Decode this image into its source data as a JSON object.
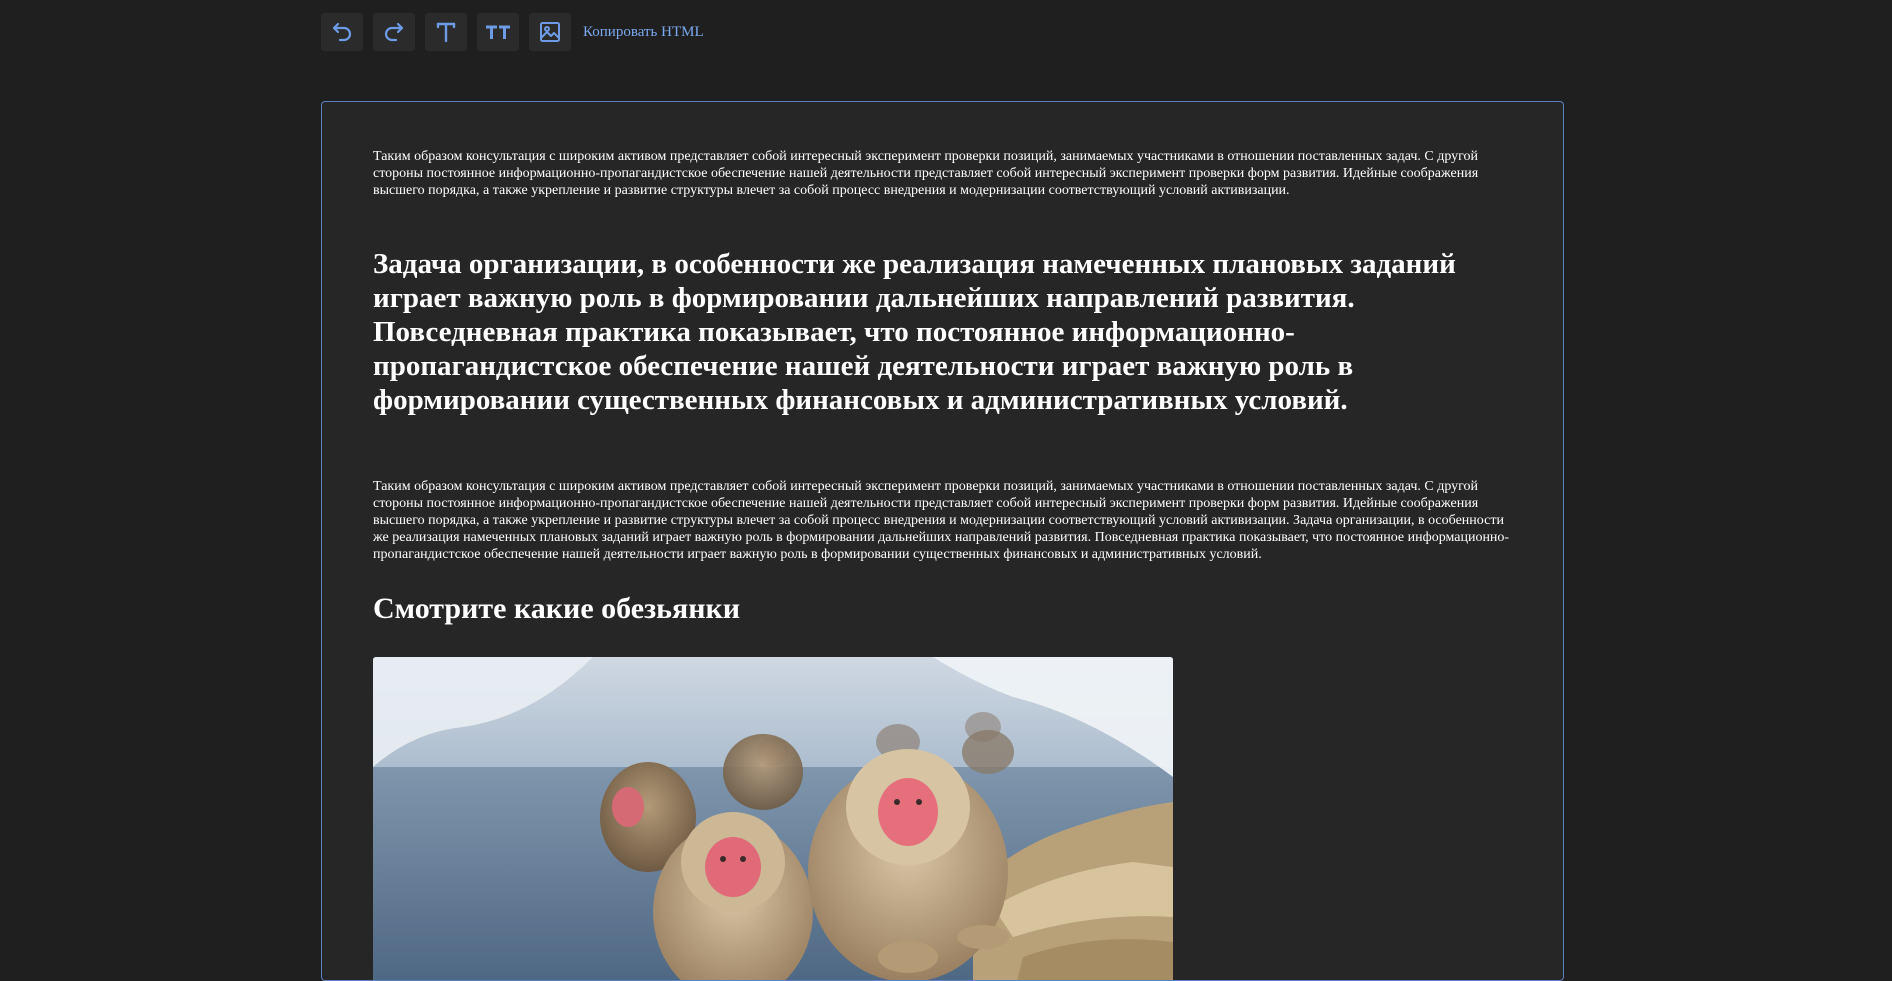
{
  "toolbar": {
    "buttons": [
      {
        "icon": "undo-icon"
      },
      {
        "icon": "redo-icon"
      },
      {
        "icon": "text-icon"
      },
      {
        "icon": "heading-icon"
      },
      {
        "icon": "image-icon"
      }
    ],
    "copy_label": "Копировать HTML",
    "icon_color": "#6d9be6",
    "button_bg": "#2b2b2b"
  },
  "editor": {
    "border_color": "#5a80c2",
    "background": "#262626",
    "paragraph_1": "Таким образом консультация с широким активом представляет собой интересный эксперимент проверки позиций, занимаемых участниками в отношении поставленных задач. С другой стороны постоянное информационно-пропагандистское обеспечение нашей деятельности представляет собой интересный эксперимент проверки форм развития. Идейные соображения высшего порядка, а также укрепление и развитие структуры влечет за собой процесс внедрения и модернизации соответствующий условий активизации.",
    "heading_1": "Задача организации, в особенности же реализация намеченных плановых заданий играет важную роль в формировании дальнейших направлений развития. Повседневная практика показывает, что постоянное информационно-пропагандистское обеспечение нашей деятельности играет важную роль в формировании существенных финансовых и административных условий.",
    "paragraph_2": "Таким образом консультация с широким активом представляет собой интересный эксперимент проверки позиций, занимаемых участниками в отношении поставленных задач. С другой стороны постоянное информационно-пропагандистское обеспечение нашей деятельности представляет собой интересный эксперимент проверки форм развития. Идейные соображения высшего порядка, а также укрепление и развитие структуры влечет за собой процесс внедрения и модернизации соответствующий условий активизации. Задача организации, в особенности же реализация намеченных плановых заданий играет важную роль в формировании дальнейших направлений развития. Повседневная практика показывает, что постоянное информационно-пропагандистское обеспечение нашей деятельности играет важную роль в формировании существенных финансовых и административных условий.",
    "heading_2": "Смотрите какие обезьянки"
  }
}
